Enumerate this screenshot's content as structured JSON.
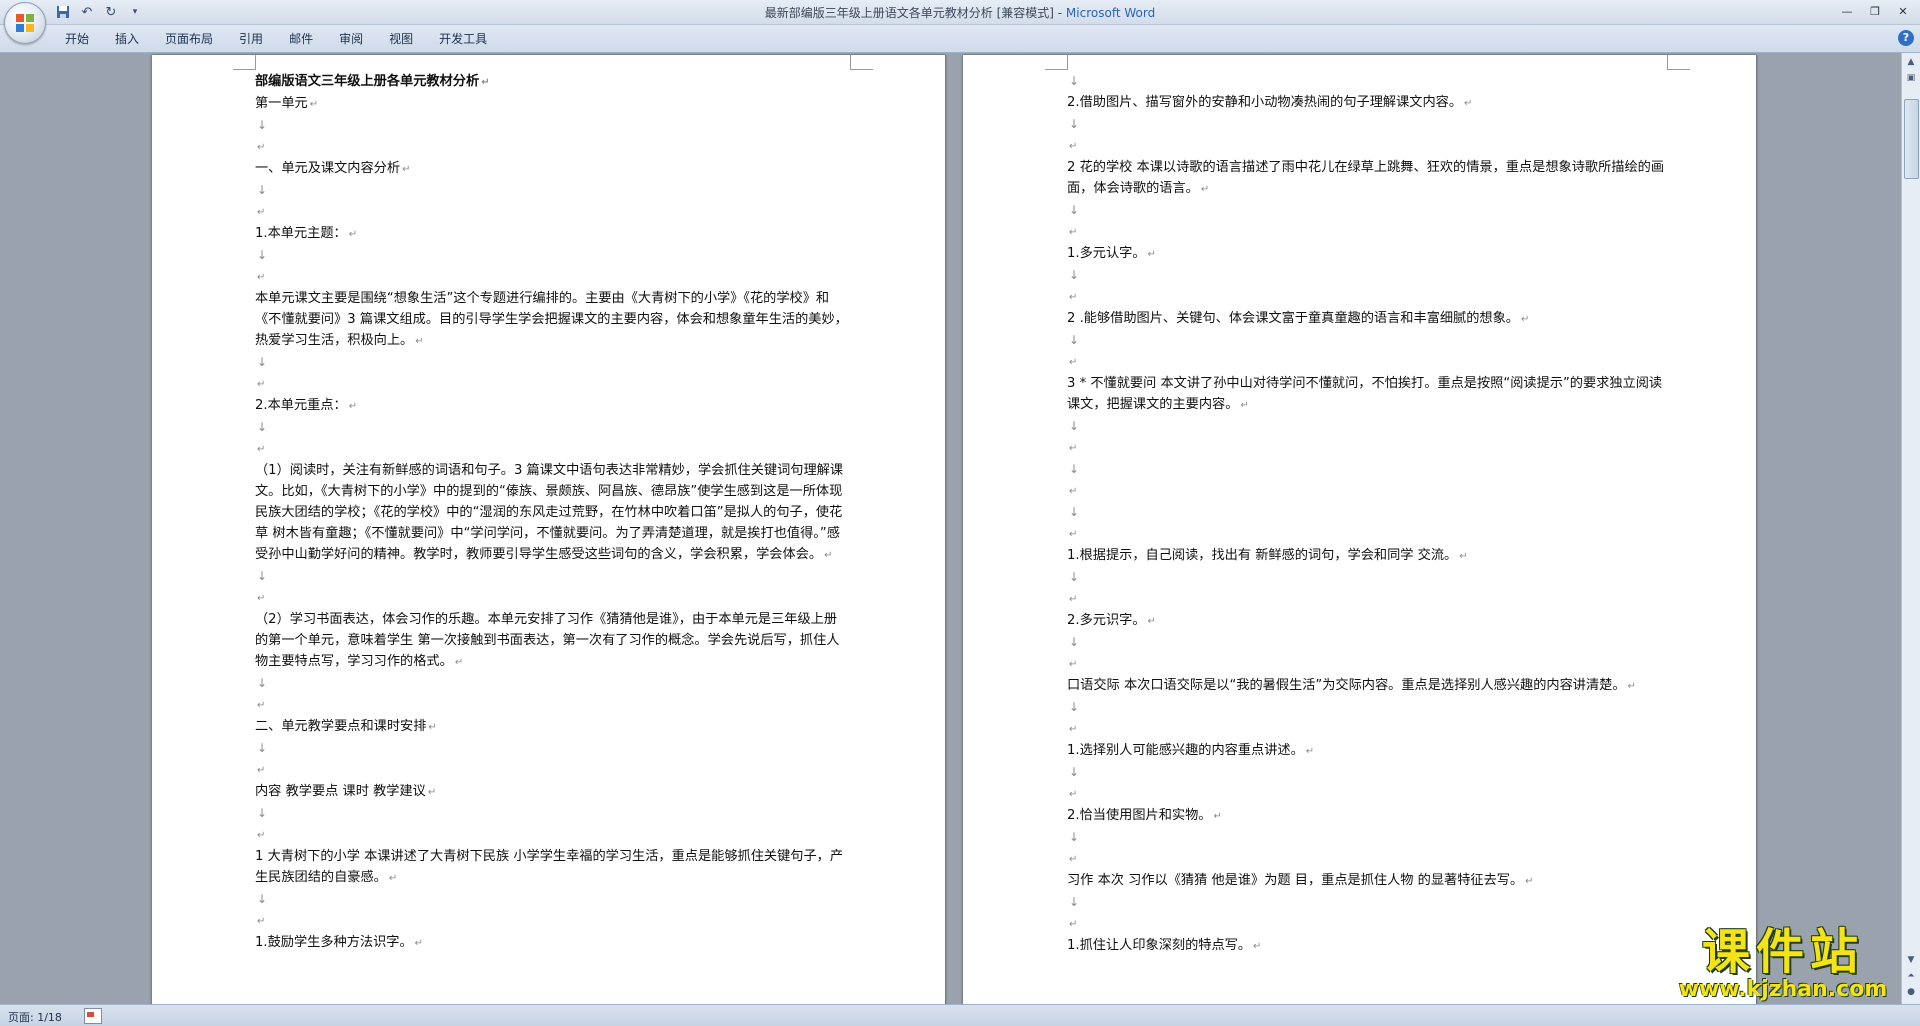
{
  "window": {
    "title": "最新部编版三年级上册语文各单元教材分析 [兼容模式] - ",
    "app": "Microsoft Word"
  },
  "qat": {
    "save_icon": "save-icon",
    "undo_icon": "undo-icon",
    "redo_icon": "redo-icon",
    "customize_icon": "chevron-down-icon"
  },
  "tabs": [
    "开始",
    "插入",
    "页面布局",
    "引用",
    "邮件",
    "审阅",
    "视图",
    "开发工具"
  ],
  "window_controls": {
    "minimize": "—",
    "restore": "❐",
    "close": "✕"
  },
  "pages": [
    {
      "paragraphs": [
        {
          "text": "部编版语文三年级上册各单元教材分析",
          "style": "title"
        },
        {
          "text": "第一单元"
        },
        {
          "text": "",
          "style": "mark"
        },
        {
          "text": "",
          "style": "empty"
        },
        {
          "text": "一、单元及课文内容分析"
        },
        {
          "text": "",
          "style": "mark"
        },
        {
          "text": "",
          "style": "empty"
        },
        {
          "text": "1.本单元主题："
        },
        {
          "text": "",
          "style": "mark"
        },
        {
          "text": "",
          "style": "empty"
        },
        {
          "text": "本单元课文主要是围绕“想象生活”这个专题进行编排的。主要由《大青树下的小学》《花的学校》和《不懂就要问》3 篇课文组成。目的引导学生学会把握课文的主要内容，体会和想象童年生活的美妙，热爱学习生活，积极向上。"
        },
        {
          "text": "",
          "style": "mark"
        },
        {
          "text": "",
          "style": "empty"
        },
        {
          "text": "2.本单元重点："
        },
        {
          "text": "",
          "style": "mark"
        },
        {
          "text": "",
          "style": "empty"
        },
        {
          "text": "（1）阅读时，关注有新鲜感的词语和句子。3 篇课文中语句表达非常精妙，学会抓住关键词句理解课文。比如，《大青树下的小学》中的提到的“傣族、景颇族、阿昌族、德昂族”使学生感到这是一所体现民族大团结的学校；《花的学校》中的“湿润的东风走过荒野，在竹林中吹着口笛”是拟人的句子，使花草 树木皆有童趣；《不懂就要问》中“学问学问，不懂就要问。为了弄清楚道理，就是挨打也值得。”感受孙中山勤学好问的精神。教学时，教师要引导学生感受这些词句的含义，学会积累，学会体会。"
        },
        {
          "text": "",
          "style": "mark"
        },
        {
          "text": "",
          "style": "empty"
        },
        {
          "text": "（2）学习书面表达，体会习作的乐趣。本单元安排了习作《猜猜他是谁》，由于本单元是三年级上册的第一个单元，意味着学生 第一次接触到书面表达，第一次有了习作的概念。学会先说后写，抓住人物主要特点写，学习习作的格式。"
        },
        {
          "text": "",
          "style": "mark"
        },
        {
          "text": "",
          "style": "empty"
        },
        {
          "text": "二、单元教学要点和课时安排"
        },
        {
          "text": "",
          "style": "mark"
        },
        {
          "text": "",
          "style": "empty"
        },
        {
          "text": "内容 教学要点 课时 教学建议"
        },
        {
          "text": "",
          "style": "mark"
        },
        {
          "text": "",
          "style": "empty"
        },
        {
          "text": "1 大青树下的小学 本课讲述了大青树下民族 小学学生幸福的学习生活，重点是能够抓住关键句子，产生民族团结的自豪感。"
        },
        {
          "text": "",
          "style": "mark"
        },
        {
          "text": "",
          "style": "empty"
        },
        {
          "text": "1.鼓励学生多种方法识字。"
        }
      ]
    },
    {
      "paragraphs": [
        {
          "text": "",
          "style": "mark"
        },
        {
          "text": "2.借助图片、描写窗外的安静和小动物凑热闹的句子理解课文内容。"
        },
        {
          "text": "",
          "style": "mark"
        },
        {
          "text": "",
          "style": "empty"
        },
        {
          "text": "2 花的学校 本课以诗歌的语言描述了雨中花儿在绿草上跳舞、狂欢的情景，重点是想象诗歌所描绘的画面，体会诗歌的语言。"
        },
        {
          "text": "",
          "style": "mark"
        },
        {
          "text": "",
          "style": "empty"
        },
        {
          "text": "1.多元认字。"
        },
        {
          "text": "",
          "style": "mark"
        },
        {
          "text": "",
          "style": "empty"
        },
        {
          "text": "2 .能够借助图片、关键句、体会课文富于童真童趣的语言和丰富细腻的想象。"
        },
        {
          "text": "",
          "style": "mark"
        },
        {
          "text": "",
          "style": "empty"
        },
        {
          "text": "3 * 不懂就要问 本文讲了孙中山对待学问不懂就问，不怕挨打。重点是按照“阅读提示”的要求独立阅读课文，把握课文的主要内容。"
        },
        {
          "text": "",
          "style": "mark"
        },
        {
          "text": "",
          "style": "empty"
        },
        {
          "text": "",
          "style": "mark"
        },
        {
          "text": "",
          "style": "empty"
        },
        {
          "text": "",
          "style": "mark"
        },
        {
          "text": "",
          "style": "empty"
        },
        {
          "text": "1.根据提示，自己阅读，找出有 新鲜感的词句，学会和同学 交流。"
        },
        {
          "text": "",
          "style": "mark"
        },
        {
          "text": "",
          "style": "empty"
        },
        {
          "text": "2.多元识字。"
        },
        {
          "text": "",
          "style": "mark"
        },
        {
          "text": "",
          "style": "empty"
        },
        {
          "text": "口语交际 本次口语交际是以“我的暑假生活”为交际内容。重点是选择别人感兴趣的内容讲清楚。"
        },
        {
          "text": "",
          "style": "mark"
        },
        {
          "text": "",
          "style": "empty"
        },
        {
          "text": "1.选择别人可能感兴趣的内容重点讲述。"
        },
        {
          "text": "",
          "style": "mark"
        },
        {
          "text": "",
          "style": "empty"
        },
        {
          "text": "2.恰当使用图片和实物。"
        },
        {
          "text": "",
          "style": "mark"
        },
        {
          "text": "",
          "style": "empty"
        },
        {
          "text": "习作 本次 习作以《猜猜 他是谁》为题 目，重点是抓住人物 的显著特征去写。"
        },
        {
          "text": "",
          "style": "mark"
        },
        {
          "text": "",
          "style": "empty"
        },
        {
          "text": "1.抓住让人印象深刻的特点写。"
        }
      ]
    }
  ],
  "statusbar": {
    "page_indicator": "页面: 1/18"
  },
  "watermark": {
    "big": "课件站",
    "url": "www.kjzhan.com"
  }
}
